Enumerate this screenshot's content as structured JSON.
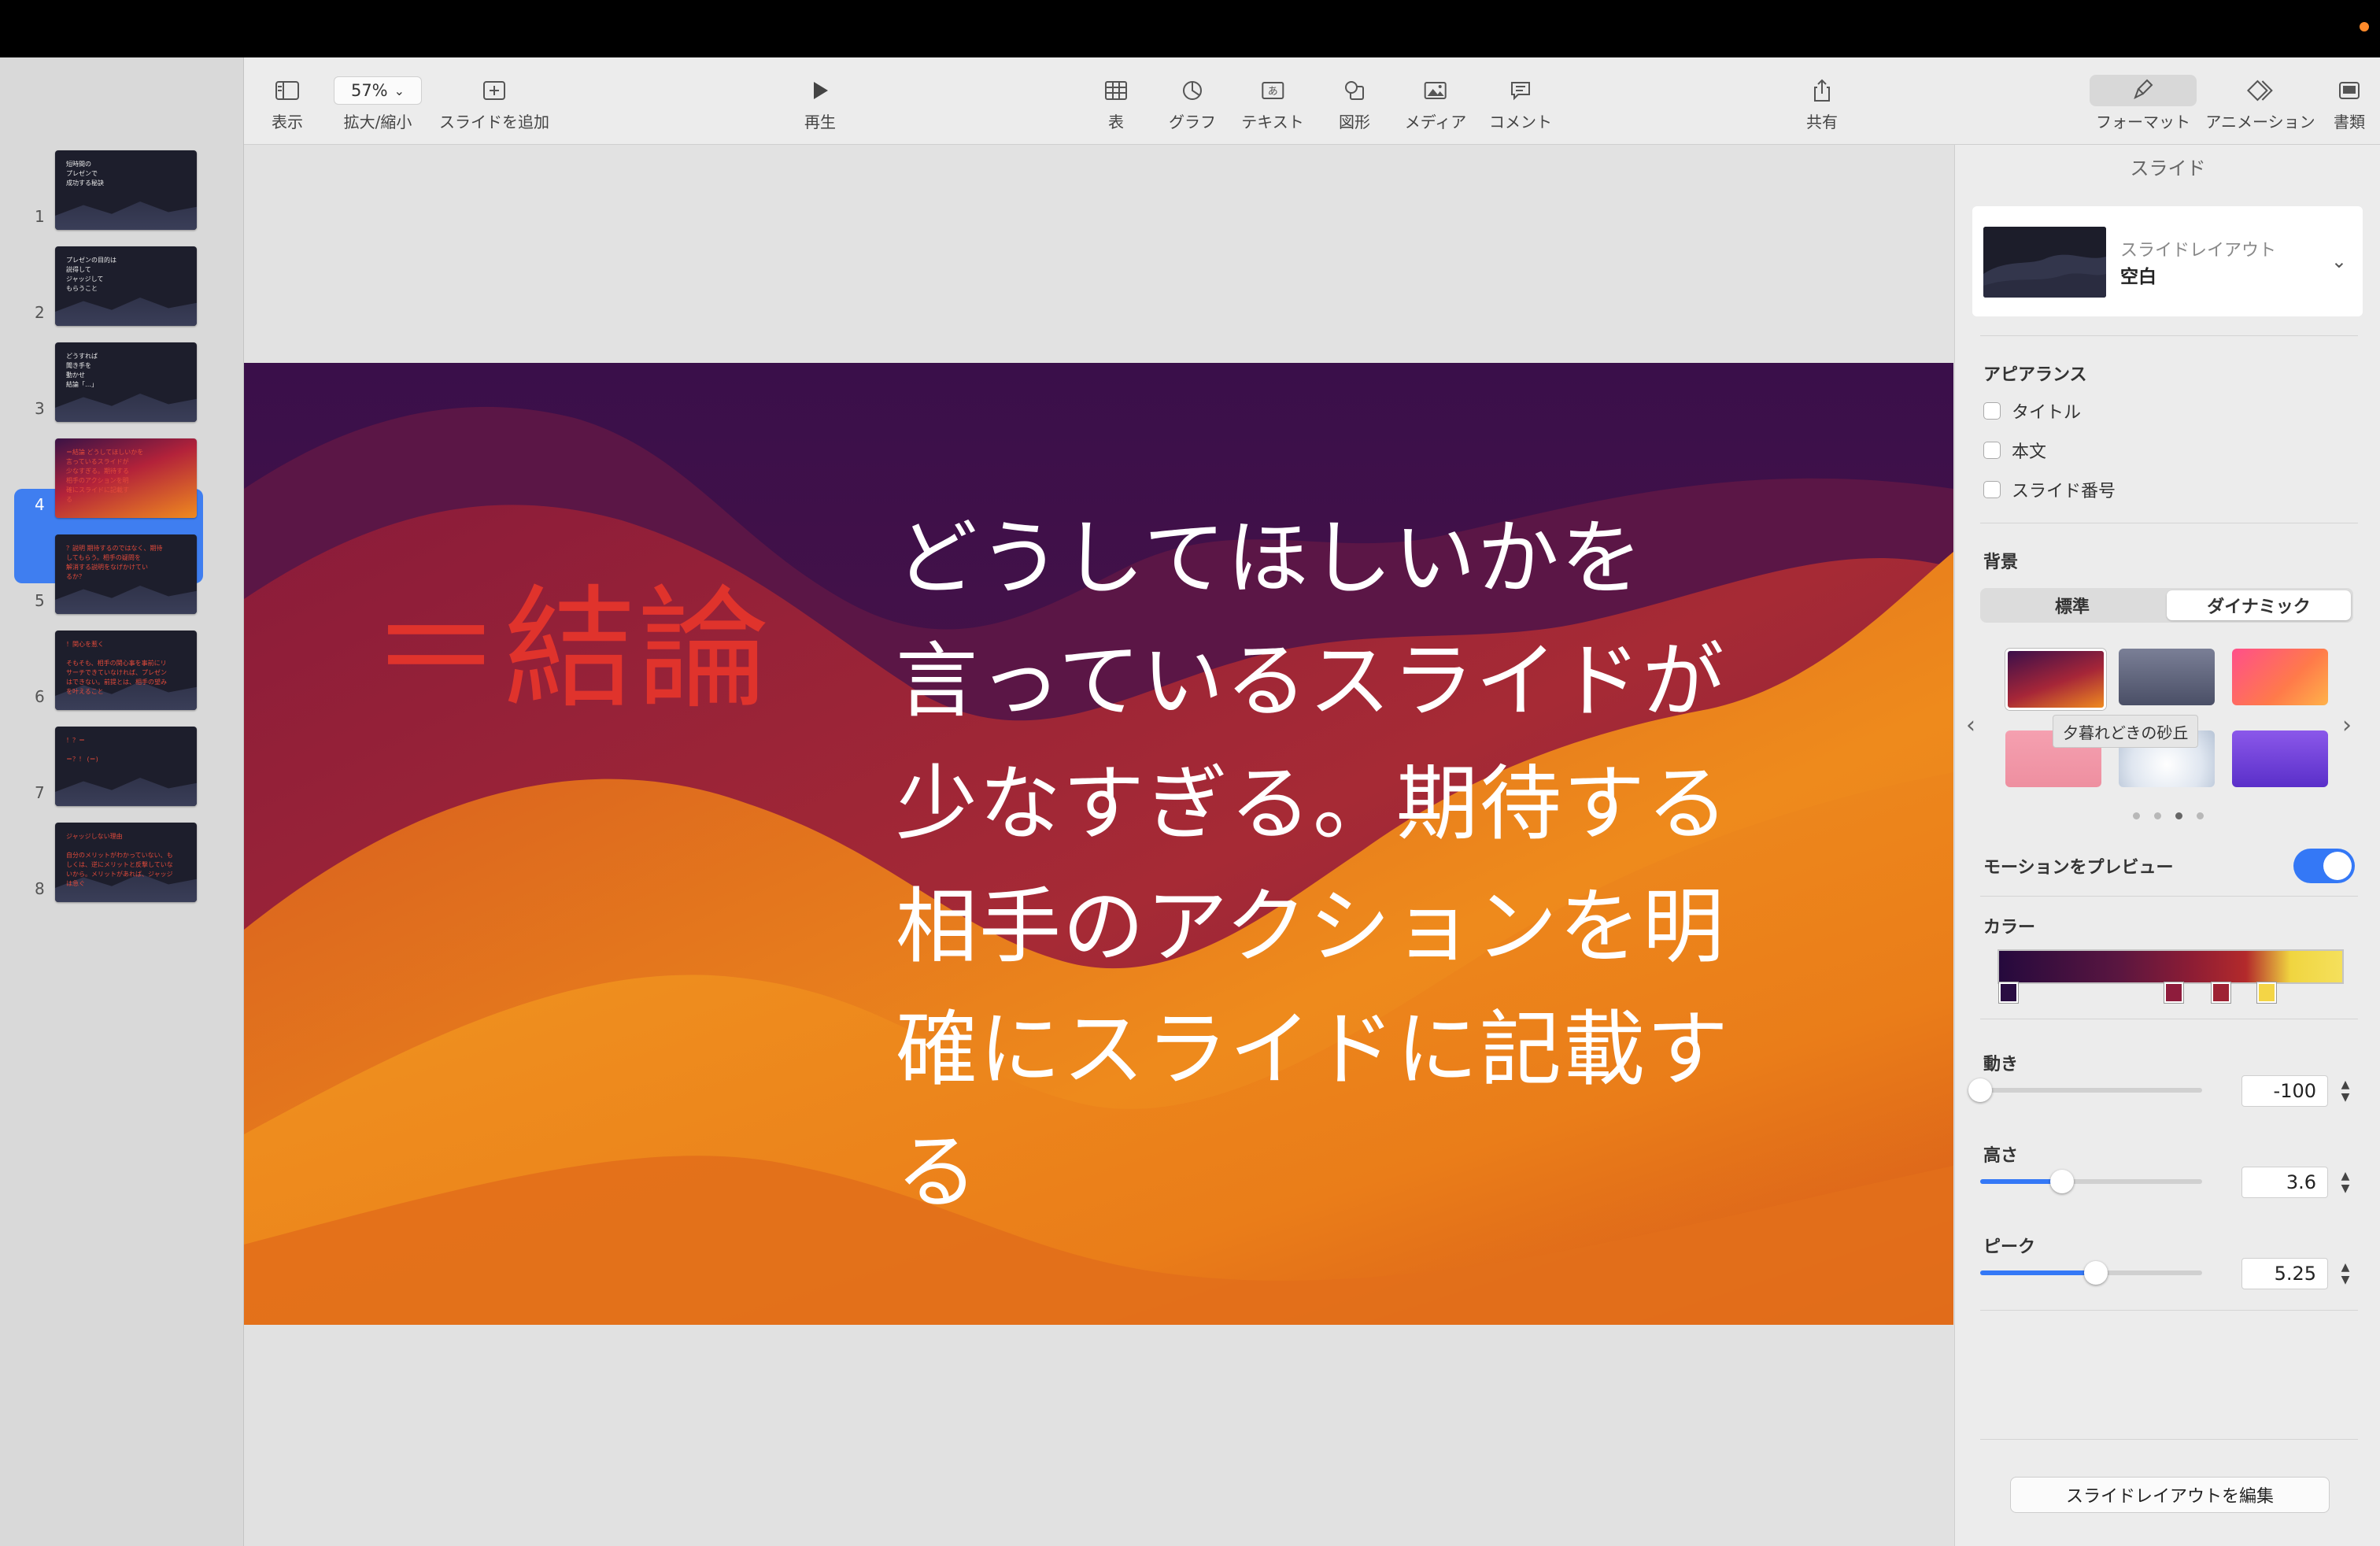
{
  "toolbar": {
    "view_label": "表示",
    "zoom_value": "57%",
    "zoom_label": "拡大/縮小",
    "add_slide_label": "スライドを追加",
    "play_label": "再生",
    "table_label": "表",
    "chart_label": "グラフ",
    "text_label": "テキスト",
    "shape_label": "図形",
    "media_label": "メディア",
    "comment_label": "コメント",
    "share_label": "共有",
    "format_label": "フォーマット",
    "animation_label": "アニメーション",
    "document_label": "書類"
  },
  "navigator": {
    "selected_index": 4,
    "slides": [
      {
        "num": "1",
        "text": "短時間の\nプレゼンで\n成功する秘訣",
        "accent": false
      },
      {
        "num": "2",
        "text": "プレゼンの目的は\n説得して\nジャッジして\nもらうこと",
        "accent": false
      },
      {
        "num": "3",
        "text": "どうすれば\n聞き手を\n動かせ\n結論「…」",
        "accent": false
      },
      {
        "num": "4",
        "text": "＝結論   どうしてほしいかを\n言っているスライドが\n少なすぎる。期待する\n相手のアクションを明\n確にスライドに記載す\nる",
        "accent": true
      },
      {
        "num": "5",
        "text": "？説明  期待するのではなく、期待\nしてもらう。相手の疑問を\n解消する説明をなげかけてい\nるか？",
        "accent": true
      },
      {
        "num": "6",
        "text": "！関心を惹く\n\nそもそも、相手の関心事を事前にリ\nサーチできていなければ、プレゼン\nはできない。前提とは、相手の望み\nを叶えること",
        "accent": true
      },
      {
        "num": "7",
        "text": "！？＝\n\n＝？！  (＝)",
        "accent": true
      },
      {
        "num": "8",
        "text": "ジャッジしない理由\n\n自分のメリットがわかっていない、も\nしくは、逆にメリットと反撃していな\nいから。メリットがあれば、ジャッジ\nは急ぐ",
        "accent": true
      }
    ]
  },
  "slide": {
    "conclusion": "＝結論",
    "body": "どうしてほしいかを\n言っているスライドが\n少なすぎる。期待する\n相手のアクションを明\n確にスライドに記載す\nる"
  },
  "inspector": {
    "title": "スライド",
    "layout_caption": "スライドレイアウト",
    "layout_name": "空白",
    "appearance_heading": "アピアランス",
    "appearance_items": [
      "タイトル",
      "本文",
      "スライド番号"
    ],
    "background_heading": "背景",
    "bg_tabs": [
      "標準",
      "ダイナミック"
    ],
    "bg_tab_active": "ダイナミック",
    "swatch_tooltip": "夕暮れどきの砂丘",
    "motion_preview_label": "モーションをプレビュー",
    "motion_preview_on": true,
    "color_heading": "カラー",
    "gradient_stops": [
      "#2a0d42",
      "#8e1c3c",
      "#9e2233",
      "#f4d546"
    ],
    "movement_label": "動き",
    "movement_value": "-100",
    "movement_level": 0.0,
    "height_label": "高さ",
    "height_value": "3.6",
    "height_level": 0.37,
    "peak_label": "ピーク",
    "peak_value": "5.25",
    "peak_level": 0.52,
    "edit_layout_button": "スライドレイアウトを編集"
  },
  "colors": {
    "accent": "#3478f6",
    "conclusion_red": "#e0332c"
  }
}
